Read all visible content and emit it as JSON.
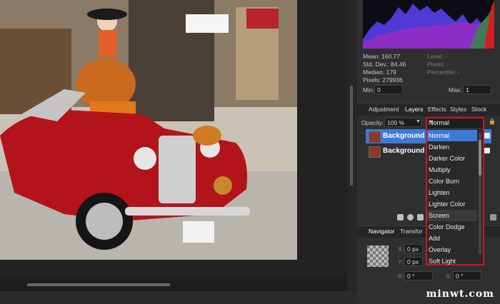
{
  "histogram": {
    "mean_label": "Mean: 160.77",
    "std_label": "Std. Dev.: 84.46",
    "median_label": "Median: 179",
    "pixels_label": "Pixels: 279936",
    "level_label": "Level: -",
    "pixels2_label": "Pixels: -",
    "percentile_label": "Percentile: -",
    "min_label": "Min:",
    "min_value": "0",
    "max_label": "Max:",
    "max_value": "1"
  },
  "panel_tabs": [
    "Adjustment",
    "Layers",
    "Effects",
    "Styles",
    "Stock"
  ],
  "layers": {
    "opacity_label": "Opacity:",
    "opacity_value": "100 %",
    "items": [
      {
        "name": "Background"
      },
      {
        "name": "Background ("
      }
    ]
  },
  "blend_mode": {
    "current": "Normal",
    "options": [
      "Normal",
      "Darken",
      "Darker Color",
      "Multiply",
      "Color Burn",
      "Lighten",
      "Lighter Color",
      "Screen",
      "Color Dodge",
      "Add",
      "Overlay",
      "Soft Light"
    ]
  },
  "navigator_tabs": [
    "Navigator",
    "Transfor"
  ],
  "transform": {
    "x_label": "X:",
    "x_value": "0 px",
    "y_label": "Y:",
    "y_value": "0 px",
    "r_label": "R:",
    "r_value": "0 °",
    "s_label": "S:",
    "s_value": "0 °"
  },
  "watermark": "minwt.com",
  "colors": {
    "selected": "#3d7ad6",
    "highlight_border": "#d0141c"
  }
}
